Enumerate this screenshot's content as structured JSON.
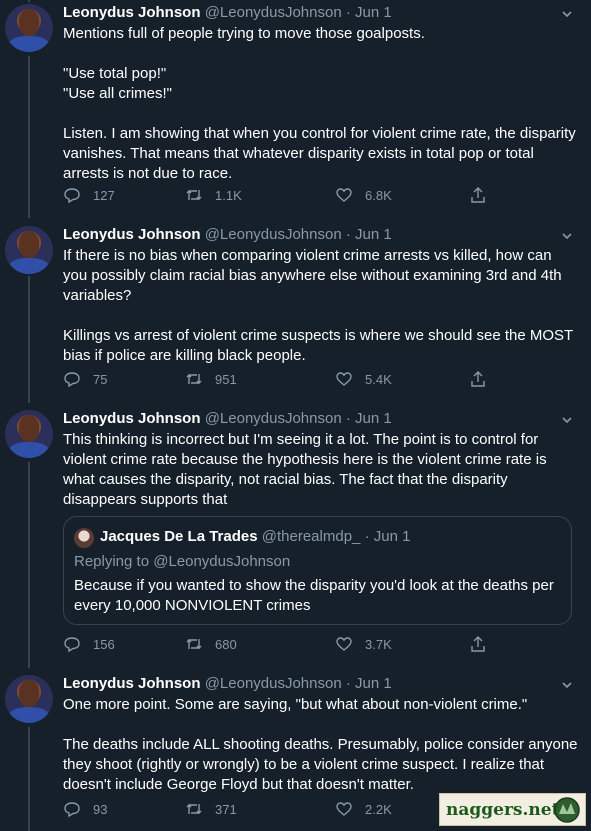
{
  "colors": {
    "background": "#15202b",
    "text": "#ffffff",
    "muted": "#8899a6",
    "border": "#38444d"
  },
  "tweets": [
    {
      "name": "Leonydus Johnson",
      "handle": "@LeonydusJohnson",
      "dot": "·",
      "date": "Jun 1",
      "paragraphs": [
        "Mentions full of people trying to move those goalposts.",
        "\"Use total pop!\"",
        "\"Use all crimes!\"",
        "Listen. I am showing that when you control for violent crime rate, the disparity vanishes. That means that whatever disparity exists in total pop or total arrests is not due to race."
      ],
      "replies": "127",
      "retweets": "1.1K",
      "likes": "6.8K"
    },
    {
      "name": "Leonydus Johnson",
      "handle": "@LeonydusJohnson",
      "dot": "·",
      "date": "Jun 1",
      "paragraphs": [
        "If there is no bias when comparing violent crime arrests vs killed, how can you possibly claim racial bias anywhere else without examining 3rd and 4th variables?",
        "Killings vs arrest of violent crime suspects is where we should see the MOST bias if police are killing black people."
      ],
      "replies": "75",
      "retweets": "951",
      "likes": "5.4K"
    },
    {
      "name": "Leonydus Johnson",
      "handle": "@LeonydusJohnson",
      "dot": "·",
      "date": "Jun 1",
      "paragraphs": [
        "This thinking is incorrect but I'm seeing it a lot. The point is to control for violent crime rate because the hypothesis here is the violent crime rate is what causes the disparity, not racial bias. The fact that the disparity disappears supports that"
      ],
      "quote": {
        "name": "Jacques De La Trades",
        "handle": "@therealmdp_",
        "dot": "·",
        "date": "Jun 1",
        "replying_to": "Replying to @LeonydusJohnson",
        "text": "Because if you wanted to show the disparity you'd look at the deaths per every 10,000 NONVIOLENT crimes"
      },
      "replies": "156",
      "retweets": "680",
      "likes": "3.7K"
    },
    {
      "name": "Leonydus Johnson",
      "handle": "@LeonydusJohnson",
      "dot": "·",
      "date": "Jun 1",
      "paragraphs": [
        "One more point. Some are saying, \"but what about non-violent crime.\"",
        "The deaths include ALL shooting deaths. Presumably, police consider anyone they shoot (rightly or wrongly) to be a violent crime suspect. I realize that doesn't include George Floyd but that doesn't matter."
      ],
      "replies": "93",
      "retweets": "371",
      "likes": "2.2K"
    }
  ],
  "watermark": {
    "text": "naggers.net"
  }
}
